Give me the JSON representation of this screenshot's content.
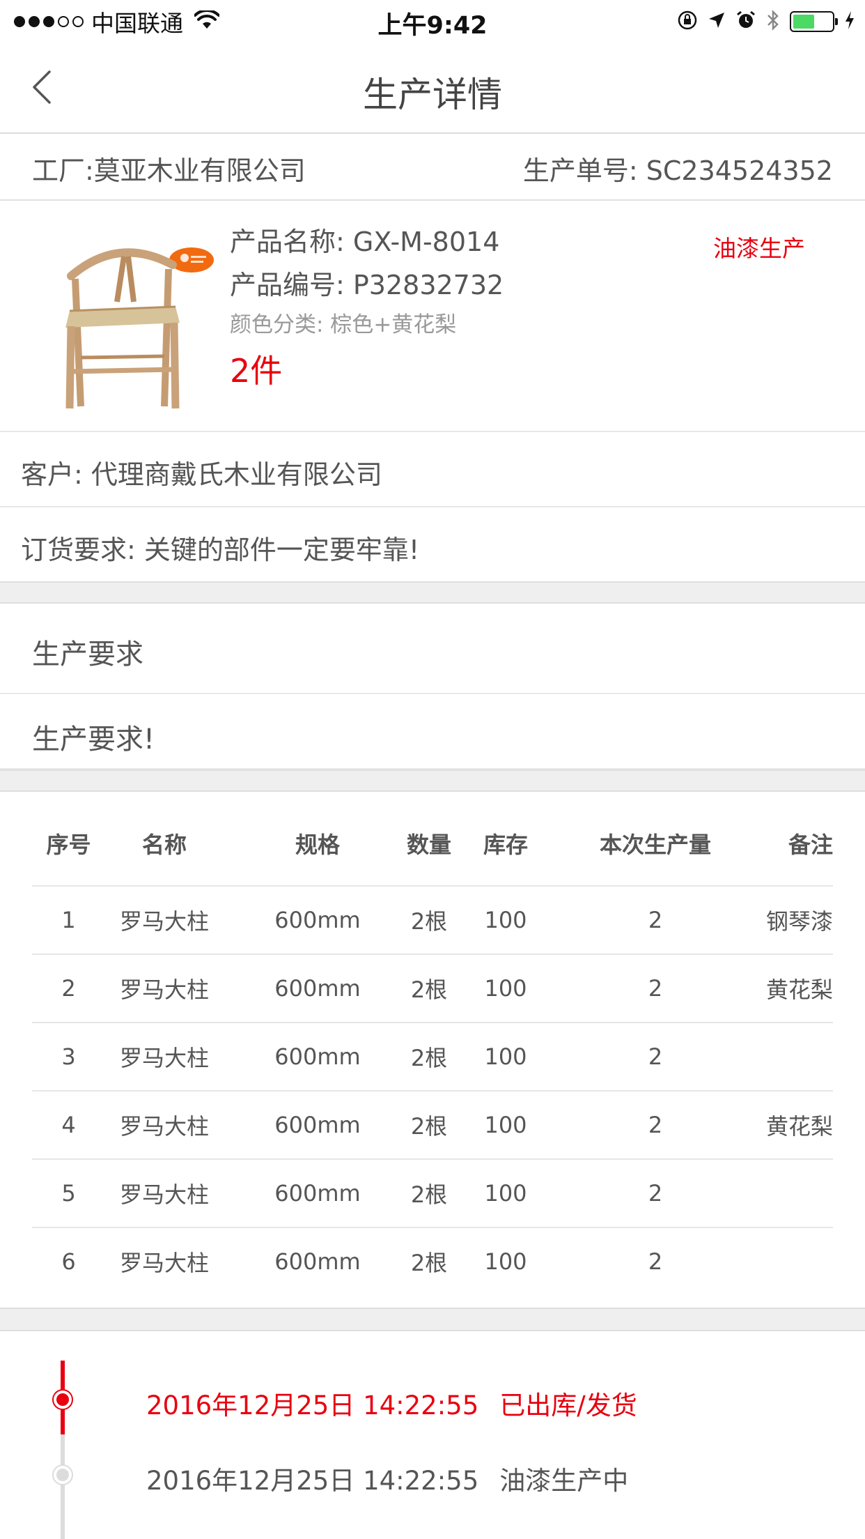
{
  "status_bar": {
    "carrier": "中国联通",
    "time": "上午9:42",
    "battery_level": 0.55,
    "signal_bars": 3
  },
  "nav": {
    "title": "生产详情"
  },
  "order": {
    "factory": "工厂:莫亚木业有限公司",
    "order_no": "生产单号: SC234524352"
  },
  "product": {
    "name": "产品名称: GX-M-8014",
    "code": "产品编号: P32832732",
    "color": "颜色分类: 棕色+黄花梨",
    "quantity": "2件",
    "status": "油漆生产"
  },
  "customer": "客户: 代理商戴氏木业有限公司",
  "order_requirement": "订货要求: 关键的部件一定要牢靠!",
  "production_req": {
    "title": "生产要求",
    "content": "生产要求!"
  },
  "table": {
    "headers": [
      "序号",
      "名称",
      "规格",
      "数量",
      "库存",
      "本次生产量",
      "备注"
    ],
    "rows": [
      [
        "1",
        "罗马大柱",
        "600mm",
        "2根",
        "100",
        "2",
        "钢琴漆"
      ],
      [
        "2",
        "罗马大柱",
        "600mm",
        "2根",
        "100",
        "2",
        "黄花梨"
      ],
      [
        "3",
        "罗马大柱",
        "600mm",
        "2根",
        "100",
        "2",
        ""
      ],
      [
        "4",
        "罗马大柱",
        "600mm",
        "2根",
        "100",
        "2",
        "黄花梨"
      ],
      [
        "5",
        "罗马大柱",
        "600mm",
        "2根",
        "100",
        "2",
        ""
      ],
      [
        "6",
        "罗马大柱",
        "600mm",
        "2根",
        "100",
        "2",
        ""
      ]
    ]
  },
  "timeline": [
    {
      "time": "2016年12月25日 14:22:55",
      "status": "已出库/发货",
      "active": true
    },
    {
      "time": "2016年12月25日 14:22:55",
      "status": "油漆生产中",
      "active": false
    }
  ],
  "colors": {
    "accent_red": "#e8000f",
    "battery_green": "#4cd964",
    "divider": "#e8e8e8",
    "section_gap": "#efefef"
  }
}
